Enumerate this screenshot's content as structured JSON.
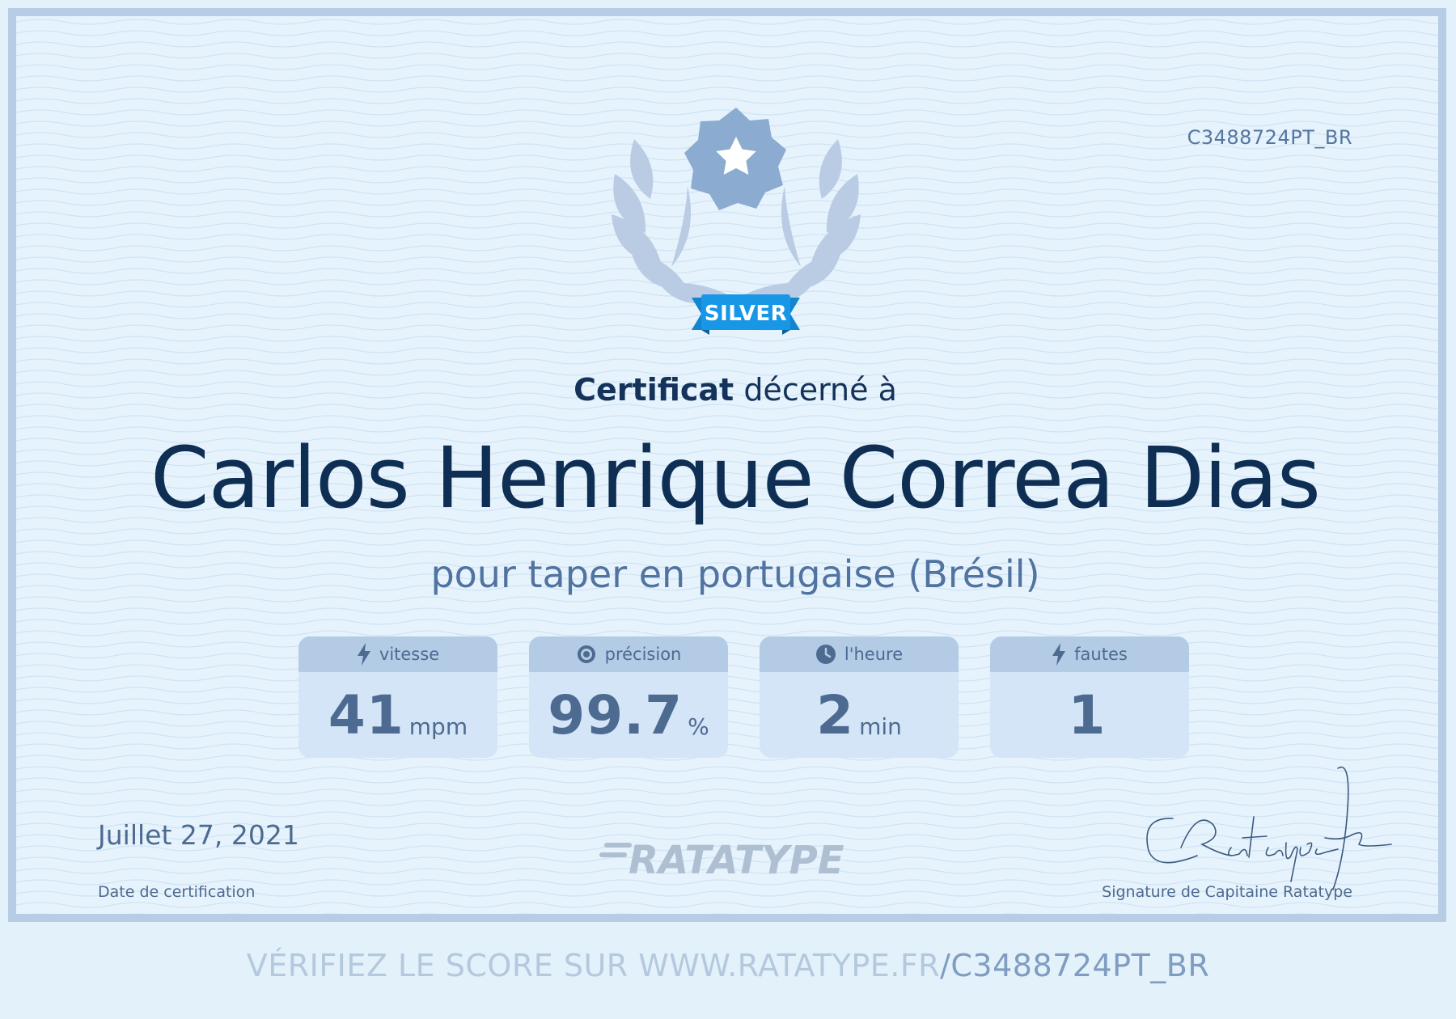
{
  "certificate": {
    "id": "C3488724PT_BR",
    "badge": "SILVER",
    "awarded_bold": "Certificat",
    "awarded_rest": "décerné à",
    "recipient": "Carlos Henrique Correa Dias",
    "subtitle": "pour taper en portugaise (Brésil)",
    "brand": "RATATYPE"
  },
  "stats": [
    {
      "label": "vitesse",
      "value": "41",
      "unit": "mpm",
      "icon": "lightning-icon"
    },
    {
      "label": "précision",
      "value": "99.7",
      "unit": "%",
      "icon": "target-icon"
    },
    {
      "label": "l'heure",
      "value": "2",
      "unit": "min",
      "icon": "clock-icon"
    },
    {
      "label": "fautes",
      "value": "1",
      "unit": "",
      "icon": "lightning-icon"
    }
  ],
  "footer": {
    "date": "Juillet 27, 2021",
    "date_label": "Date de certification",
    "signature_label": "Signature de Capitaine Ratatype",
    "verify_prefix": "VÉRIFIEZ LE SCORE SUR WWW.RATATYPE.FR",
    "verify_code": "/C3488724PT_BR"
  },
  "colors": {
    "background": "#e6f3fc",
    "border": "#b7cde5",
    "name": "#0e2e54",
    "accent_badge": "#1797e6",
    "stat_text": "#4d6a91"
  }
}
